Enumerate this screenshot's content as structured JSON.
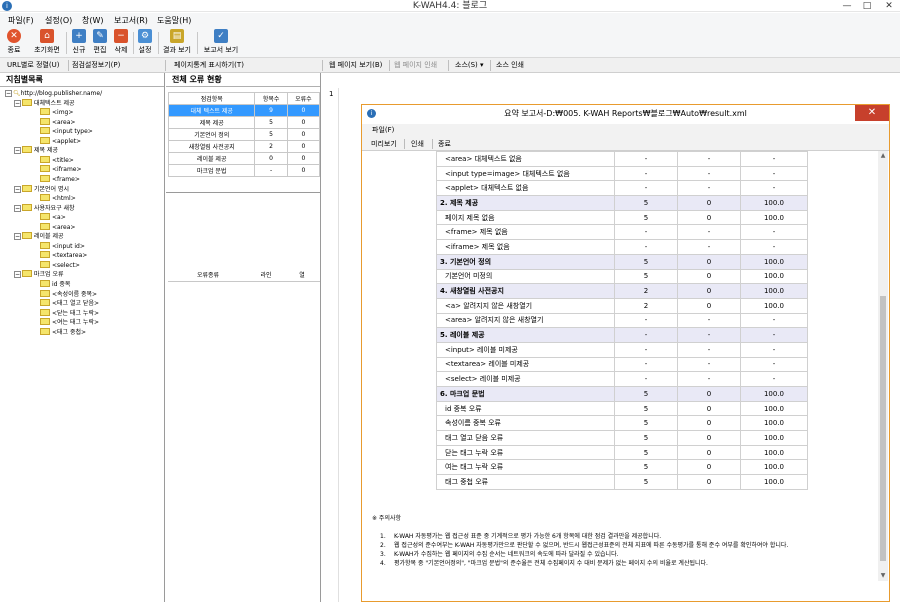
{
  "window": {
    "title": "K-WAH4.4: 블로그",
    "minimize": "—",
    "maximize": "□",
    "close": "✕"
  },
  "menu": [
    "파일(F)",
    "설정(O)",
    "창(W)",
    "보고서(R)",
    "도움말(H)"
  ],
  "toolbar": [
    {
      "label": "종료",
      "icon": "exit-icon",
      "color": "#e0542e"
    },
    {
      "label": "초기화면",
      "icon": "home-icon",
      "color": "#d9532c"
    },
    {
      "label": "신규",
      "icon": "new-icon",
      "color": "#3f7fc4"
    },
    {
      "label": "편집",
      "icon": "edit-icon",
      "color": "#3f7fc4"
    },
    {
      "label": "삭제",
      "icon": "delete-icon",
      "color": "#d9532c"
    },
    {
      "label": "설정",
      "icon": "settings-icon",
      "color": "#4a8fd4"
    },
    {
      "label": "결과 보기",
      "icon": "result-icon",
      "color": "#c9a62a"
    },
    {
      "label": "보고서 보기",
      "icon": "report-icon",
      "color": "#3f7fc4"
    }
  ],
  "subbar": {
    "url_sort": "URL별로 정렬(U)",
    "check_settings": "점검설정보기(P)",
    "page_stats": "페이지통계 표시하기(T)",
    "web_page": "웹 페이지 보기(B)",
    "web_print": "웹 페이지 인쇄",
    "source": "소스(S)",
    "source_print": "소스 인쇄"
  },
  "tree": {
    "header": "지침별목록",
    "root": "http://blog.publisher.name/",
    "groups": [
      {
        "label": "대체텍스트 제공",
        "items": [
          "<img>",
          "<area>",
          "<input type>",
          "<applet>"
        ]
      },
      {
        "label": "제목 제공",
        "items": [
          "<title>",
          "<iframe>",
          "<frame>"
        ]
      },
      {
        "label": "기본언어 명시",
        "items": [
          "<html>"
        ]
      },
      {
        "label": "사용자요구 새창",
        "items": [
          "<a>",
          "<area>"
        ]
      },
      {
        "label": "레이블 제공",
        "items": [
          "<input id>",
          "<textarea>",
          "<select>"
        ]
      },
      {
        "label": "마크업 오류",
        "items": [
          "id 중복",
          "<속성이름 중복>",
          "<태그 열고 닫음>",
          "<닫는 태그 누락>",
          "<여는 태그 누락>",
          "<태그 중첩>"
        ]
      }
    ]
  },
  "summary": {
    "header": "전체 오류 현황",
    "columns": [
      "점검항목",
      "항목수",
      "오류수"
    ],
    "rows": [
      [
        "대체 텍스트 제공",
        "9",
        "0"
      ],
      [
        "제목 제공",
        "5",
        "0"
      ],
      [
        "기본언어 정의",
        "5",
        "0"
      ],
      [
        "새창열림 사전공지",
        "2",
        "0"
      ],
      [
        "레이블 제공",
        "0",
        "0"
      ],
      [
        "마크업 문법",
        "-",
        "0"
      ]
    ],
    "selected_row": 0
  },
  "errors": {
    "columns": [
      "오류종류",
      "라인",
      "열"
    ]
  },
  "editor": {
    "line_number": "1"
  },
  "report": {
    "title": "요약 보고서-D:₩005. K-WAH Reports₩블로그₩Auto₩result.xml",
    "menu": "파일(F)",
    "tools": [
      "미리보기",
      "인쇄",
      "종료"
    ],
    "rows": [
      {
        "name": "<area> 대체텍스트 없음",
        "c1": "-",
        "c2": "-",
        "c3": "-",
        "cat": false
      },
      {
        "name": "<input type=image> 대체텍스트 없음",
        "c1": "-",
        "c2": "-",
        "c3": "-",
        "cat": false
      },
      {
        "name": "<applet> 대체텍스트 없음",
        "c1": "-",
        "c2": "-",
        "c3": "-",
        "cat": false
      },
      {
        "name": "2. 제목 제공",
        "c1": "5",
        "c2": "0",
        "c3": "100.0",
        "cat": true
      },
      {
        "name": "페이지 제목 없음",
        "c1": "5",
        "c2": "0",
        "c3": "100.0",
        "cat": false
      },
      {
        "name": "<frame> 제목 없음",
        "c1": "-",
        "c2": "-",
        "c3": "-",
        "cat": false
      },
      {
        "name": "<iframe> 제목 없음",
        "c1": "-",
        "c2": "-",
        "c3": "-",
        "cat": false
      },
      {
        "name": "3. 기본언어 정의",
        "c1": "5",
        "c2": "0",
        "c3": "100.0",
        "cat": true
      },
      {
        "name": "기본언어 미정의",
        "c1": "5",
        "c2": "0",
        "c3": "100.0",
        "cat": false
      },
      {
        "name": "4. 새창열림 사전공지",
        "c1": "2",
        "c2": "0",
        "c3": "100.0",
        "cat": true
      },
      {
        "name": "<a> 알려지지 않은 새창열기",
        "c1": "2",
        "c2": "0",
        "c3": "100.0",
        "cat": false
      },
      {
        "name": "<area> 알려지지 않은 새창열기",
        "c1": "-",
        "c2": "-",
        "c3": "-",
        "cat": false
      },
      {
        "name": "5. 레이블 제공",
        "c1": "-",
        "c2": "-",
        "c3": "-",
        "cat": true
      },
      {
        "name": "<input> 레이블 미제공",
        "c1": "-",
        "c2": "-",
        "c3": "-",
        "cat": false
      },
      {
        "name": "<textarea> 레이블 미제공",
        "c1": "-",
        "c2": "-",
        "c3": "-",
        "cat": false
      },
      {
        "name": "<select> 레이블 미제공",
        "c1": "-",
        "c2": "-",
        "c3": "-",
        "cat": false
      },
      {
        "name": "6. 마크업 문법",
        "c1": "5",
        "c2": "0",
        "c3": "100.0",
        "cat": true
      },
      {
        "name": "id 중복 오류",
        "c1": "5",
        "c2": "0",
        "c3": "100.0",
        "cat": false
      },
      {
        "name": "속성이름 중복 오류",
        "c1": "5",
        "c2": "0",
        "c3": "100.0",
        "cat": false
      },
      {
        "name": "태그 열고 닫음 오류",
        "c1": "5",
        "c2": "0",
        "c3": "100.0",
        "cat": false
      },
      {
        "name": "닫는 태그 누락 오류",
        "c1": "5",
        "c2": "0",
        "c3": "100.0",
        "cat": false
      },
      {
        "name": "여는 태그 누락 오류",
        "c1": "5",
        "c2": "0",
        "c3": "100.0",
        "cat": false
      },
      {
        "name": "태그 중첩 오류",
        "c1": "5",
        "c2": "0",
        "c3": "100.0",
        "cat": false
      }
    ],
    "notes_title": "※ 주의사항",
    "notes": [
      "K-WAH 자동평가는 웹 접근성 표준 중 기계적으로 평가 가능한 6개 항목에 대한 점검 결과만을 제공합니다.",
      "웹 접근성의 준수여부는 K-WAH 자동평가만으로 판단할 수 없으며, 반드시 웹접근성표준의 전체 지표에 따른 수동평가를 통해 준수 여부를 확인하여야 합니다.",
      "K-WAH가 수집하는 웹 페이지의 수집 순서는 네트워크의 속도에 따라 달라질 수 있습니다.",
      "평가항목 중 \"기본언어정의\", \"마크업 문법\"의 준수율은 전체 수집페이지 수 대비 문제가 없는 페이지 수의 비율로 계산됩니다."
    ]
  },
  "colors": {
    "accent": "#3399ff",
    "dialog_border": "#e89b2e",
    "close_button": "#c7402c",
    "category_row": "#e9e9f6"
  }
}
